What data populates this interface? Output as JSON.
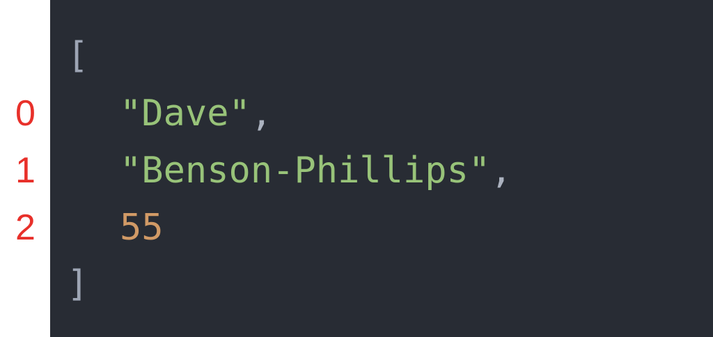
{
  "code": {
    "open_bracket": "[",
    "close_bracket": "]",
    "items": [
      {
        "text": "\"Dave\"",
        "comma": ",",
        "kind": "string"
      },
      {
        "text": "\"Benson-Phillips\"",
        "comma": ",",
        "kind": "string"
      },
      {
        "text": "55",
        "comma": "",
        "kind": "number"
      }
    ]
  },
  "indices": [
    "0",
    "1",
    "2"
  ],
  "colors": {
    "background": "#282c34",
    "string": "#98c379",
    "number": "#d19a66",
    "bracket": "#9da5b4",
    "index_label": "#e8302a"
  }
}
